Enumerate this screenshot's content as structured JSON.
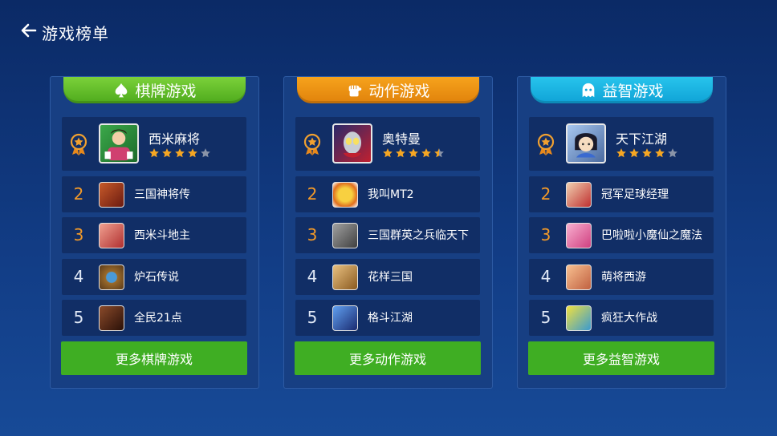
{
  "header": {
    "title": "游戏榜单",
    "back_icon": "arrow-left-icon"
  },
  "colors": {
    "tab_green": "#5cb925",
    "tab_orange": "#ec9113",
    "tab_cyan": "#1bb3e0",
    "rank_hot": "#f49a28",
    "button_green": "#3fae23",
    "star": "#f5a623"
  },
  "panels": [
    {
      "tab": {
        "label": "棋牌游戏",
        "icon": "spade-icon"
      },
      "top": {
        "name": "西米麻将",
        "rating": 4,
        "thumb_color": "#2a8a3a"
      },
      "items": [
        {
          "rank": "2",
          "name": "三国神将传",
          "thumb_color": "#b04020"
        },
        {
          "rank": "3",
          "name": "西米斗地主",
          "thumb_color": "#d0604a"
        },
        {
          "rank": "4",
          "name": "炉石传说",
          "thumb_color": "#8a6a3a"
        },
        {
          "rank": "5",
          "name": "全民21点",
          "thumb_color": "#5a3020"
        }
      ],
      "more": "更多棋牌游戏"
    },
    {
      "tab": {
        "label": "动作游戏",
        "icon": "fist-icon"
      },
      "top": {
        "name": "奥特曼",
        "rating": 4.5,
        "thumb_color": "#c02030"
      },
      "items": [
        {
          "rank": "2",
          "name": "我叫MT2",
          "thumb_color": "#e0b030"
        },
        {
          "rank": "3",
          "name": "三国群英之兵临天下",
          "thumb_color": "#707070"
        },
        {
          "rank": "4",
          "name": "花样三国",
          "thumb_color": "#c08a40"
        },
        {
          "rank": "5",
          "name": "格斗江湖",
          "thumb_color": "#2a4aa0"
        }
      ],
      "more": "更多动作游戏"
    },
    {
      "tab": {
        "label": "益智游戏",
        "icon": "ghost-icon"
      },
      "top": {
        "name": "天下江湖",
        "rating": 4,
        "thumb_color": "#7aa0d0"
      },
      "items": [
        {
          "rank": "2",
          "name": "冠军足球经理",
          "thumb_color": "#c03030"
        },
        {
          "rank": "3",
          "name": "巴啦啦小魔仙之魔法",
          "thumb_color": "#e070a0"
        },
        {
          "rank": "4",
          "name": "萌将西游",
          "thumb_color": "#d08060"
        },
        {
          "rank": "5",
          "name": "疯狂大作战",
          "thumb_color": "#3a9ad0"
        }
      ],
      "more": "更多益智游戏"
    }
  ]
}
